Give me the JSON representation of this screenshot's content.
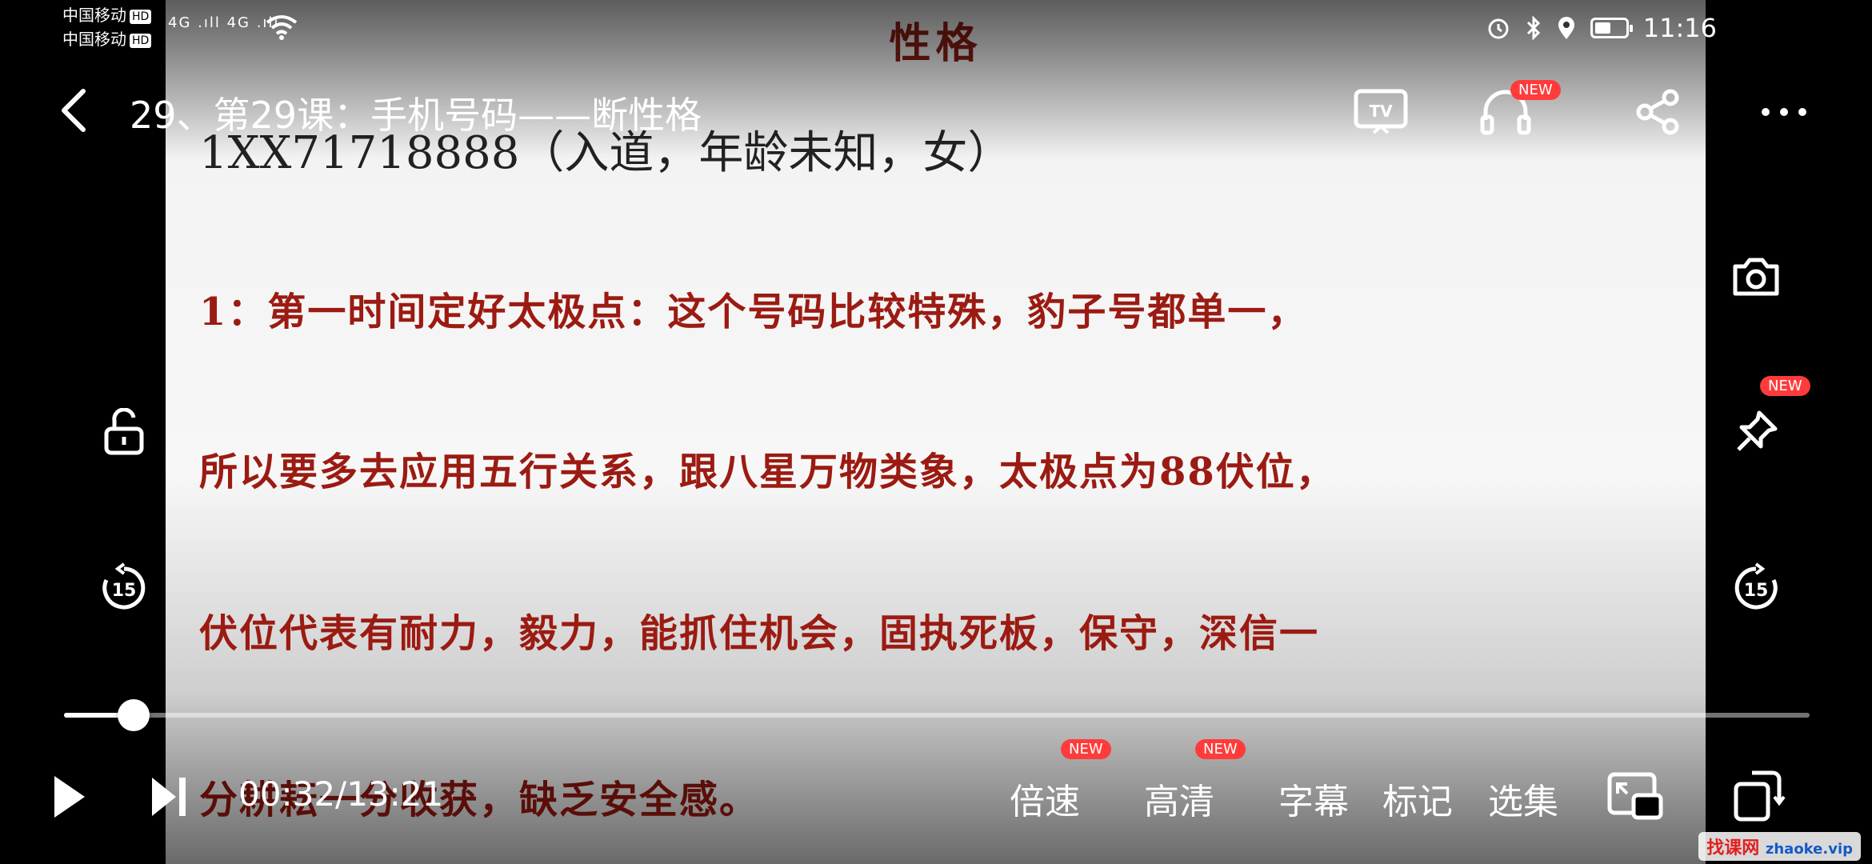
{
  "status_bar": {
    "carrier1": "中国移动",
    "carrier2": "中国移动",
    "hd": "HD",
    "signals": "4G .ıll 4G .ıll",
    "time": "11:16",
    "battery_level": 0.6
  },
  "header": {
    "title": "29、第29课：手机号码——断性格",
    "new_badge": "NEW"
  },
  "slide": {
    "title": "性格",
    "number": "1XX71718888（入道，年龄未知，女）",
    "line1": "1：第一时间定好太极点：这个号码比较特殊，豹子号都单一，",
    "line2": "所以要多去应用五行关系，跟八星万物类象，太极点为88伏位，",
    "line3": "伏位代表有耐力，毅力，能抓住机会，固执死板，保守，深信一",
    "line4": "分耕耘一分收获，缺乏安全感。"
  },
  "side": {
    "pin_badge": "NEW",
    "skip_seconds": "15"
  },
  "player": {
    "current_time": "00:32",
    "duration": "13:21",
    "time_display": "00:32/13:21",
    "progress": 0.04,
    "speed_label": "倍速",
    "quality_label": "高清",
    "subtitle_label": "字幕",
    "mark_label": "标记",
    "episodes_label": "选集",
    "speed_badge": "NEW",
    "quality_badge": "NEW"
  },
  "watermark": {
    "text": "找课网",
    "domain": "zhaoke.vip"
  }
}
